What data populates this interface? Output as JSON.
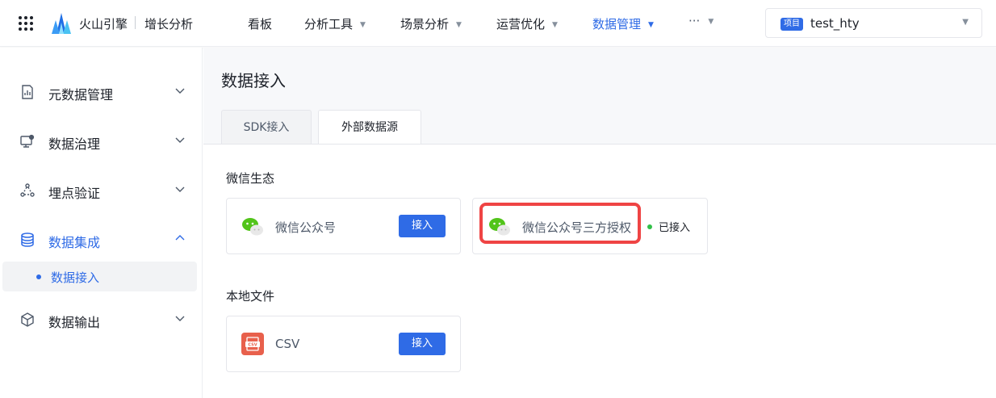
{
  "header": {
    "brand": "火山引擎",
    "product": "增长分析",
    "nav": [
      {
        "label": "看板",
        "has_caret": false
      },
      {
        "label": "分析工具",
        "has_caret": true
      },
      {
        "label": "场景分析",
        "has_caret": true
      },
      {
        "label": "运营优化",
        "has_caret": true
      },
      {
        "label": "数据管理",
        "has_caret": true,
        "active": true
      },
      {
        "label": "···",
        "has_caret": true
      }
    ],
    "project": {
      "badge": "项目",
      "name": "test_hty"
    }
  },
  "sidebar": {
    "items": [
      {
        "label": "元数据管理",
        "icon": "chart-doc-icon",
        "expanded": false
      },
      {
        "label": "数据治理",
        "icon": "monitor-gear-icon",
        "expanded": false
      },
      {
        "label": "埋点验证",
        "icon": "nodes-icon",
        "expanded": false
      },
      {
        "label": "数据集成",
        "icon": "database-icon",
        "expanded": true,
        "active": true
      },
      {
        "label": "数据输出",
        "icon": "cube-icon",
        "expanded": false
      }
    ],
    "sub_item": "数据接入"
  },
  "main": {
    "title": "数据接入",
    "tabs": [
      {
        "label": "SDK接入",
        "active": false
      },
      {
        "label": "外部数据源",
        "active": true
      }
    ],
    "sections": [
      {
        "title": "微信生态",
        "cards": [
          {
            "label": "微信公众号",
            "icon": "wechat-icon",
            "button": "接入"
          },
          {
            "label": "微信公众号三方授权",
            "icon": "wechat-icon",
            "status": "已接入",
            "highlighted": true
          }
        ]
      },
      {
        "title": "本地文件",
        "cards": [
          {
            "label": "CSV",
            "icon": "csv-file-icon",
            "icon_text": "CSV",
            "button": "接入"
          }
        ]
      }
    ]
  },
  "colors": {
    "accent": "#2f6be6",
    "status_green": "#31c048",
    "highlight_red": "#ef4444"
  }
}
